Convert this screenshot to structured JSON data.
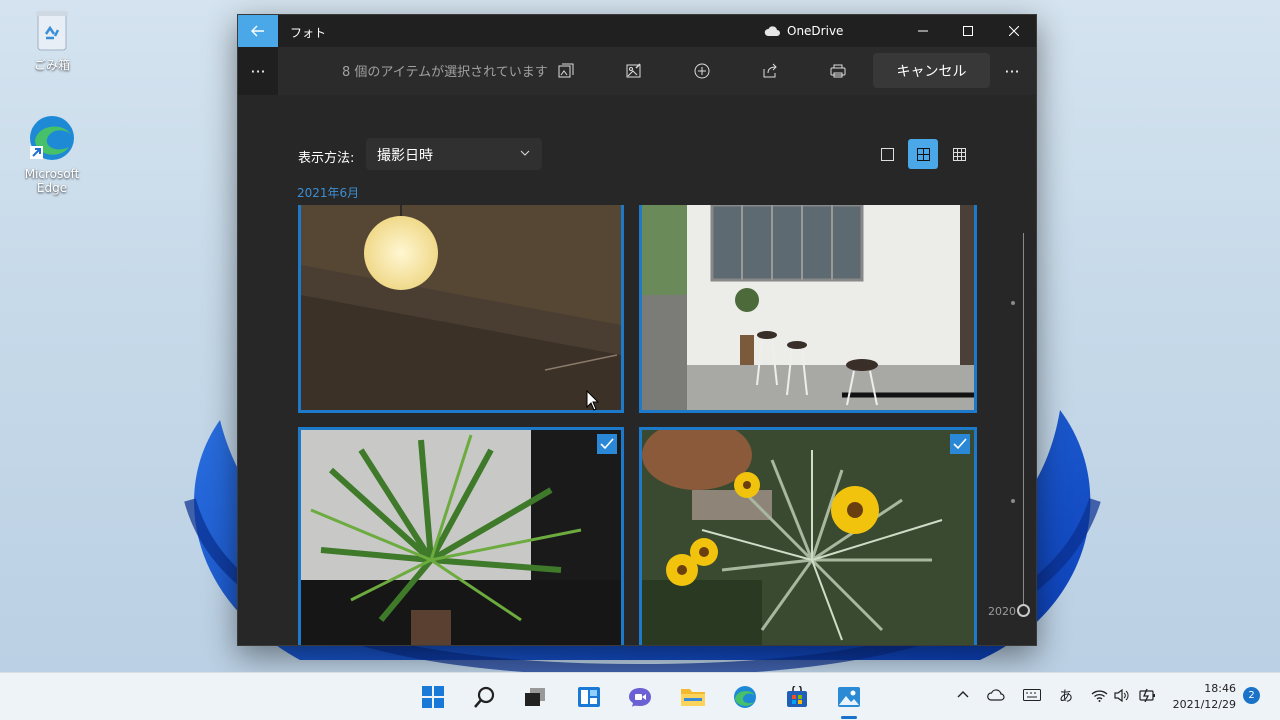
{
  "desktop": {
    "recycle_bin_label": "ごみ箱",
    "edge_label": "Microsoft Edge"
  },
  "window": {
    "app_title": "フォト",
    "onedrive_label": "OneDrive"
  },
  "toolbar": {
    "selection_text": "8 個のアイテムが選択されています",
    "cancel_label": "キャンセル",
    "icons": [
      "slideshow-icon",
      "edit-image-icon",
      "add-icon",
      "share-icon",
      "print-icon"
    ]
  },
  "view": {
    "label": "表示方法:",
    "selected": "撮影日時",
    "modes": [
      "single-view-icon",
      "medium-grid-icon",
      "small-grid-icon"
    ],
    "active_mode": "medium-grid-icon"
  },
  "gallery": {
    "month": "2021年6月",
    "photos": [
      {
        "subject": "ceiling-lamp",
        "selected": false
      },
      {
        "subject": "cafe-storefront",
        "selected": false
      },
      {
        "subject": "sago-palm",
        "selected": true
      },
      {
        "subject": "gazania-flowers",
        "selected": true
      }
    ]
  },
  "timeline": {
    "year": "2020"
  },
  "taskbar": {
    "ime": "あ",
    "time": "18:46",
    "date": "2021/12/29",
    "notifications": "2"
  }
}
